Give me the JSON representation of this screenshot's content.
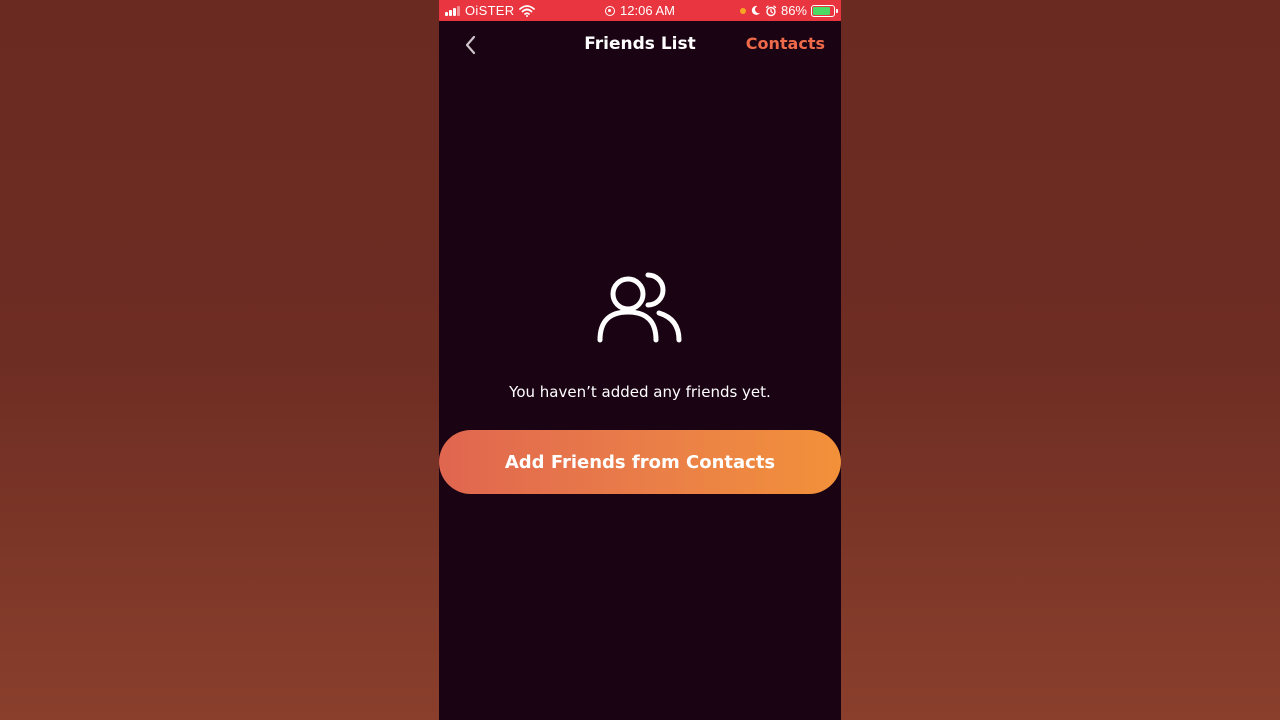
{
  "status_bar": {
    "carrier": "OiSTER",
    "time": "12:06 AM",
    "battery_percent": "86%",
    "battery_level": 0.86,
    "icons": [
      "signal-icon",
      "wifi-icon",
      "screen-record-icon",
      "orange-dot-indicator",
      "moon-icon",
      "alarm-icon",
      "battery-charging-icon"
    ]
  },
  "nav": {
    "back_icon": "chevron-left-icon",
    "title": "Friends List",
    "action_label": "Contacts"
  },
  "empty_state": {
    "icon": "users-icon",
    "message": "You haven’t added any friends yet.",
    "button_label": "Add Friends from Contacts"
  },
  "colors": {
    "status_bar_bg": "#e9353f",
    "screen_bg": "#1a0313",
    "accent": "#ef6a4a",
    "button_gradient_start": "#e0664f",
    "button_gradient_end": "#f2913a"
  }
}
